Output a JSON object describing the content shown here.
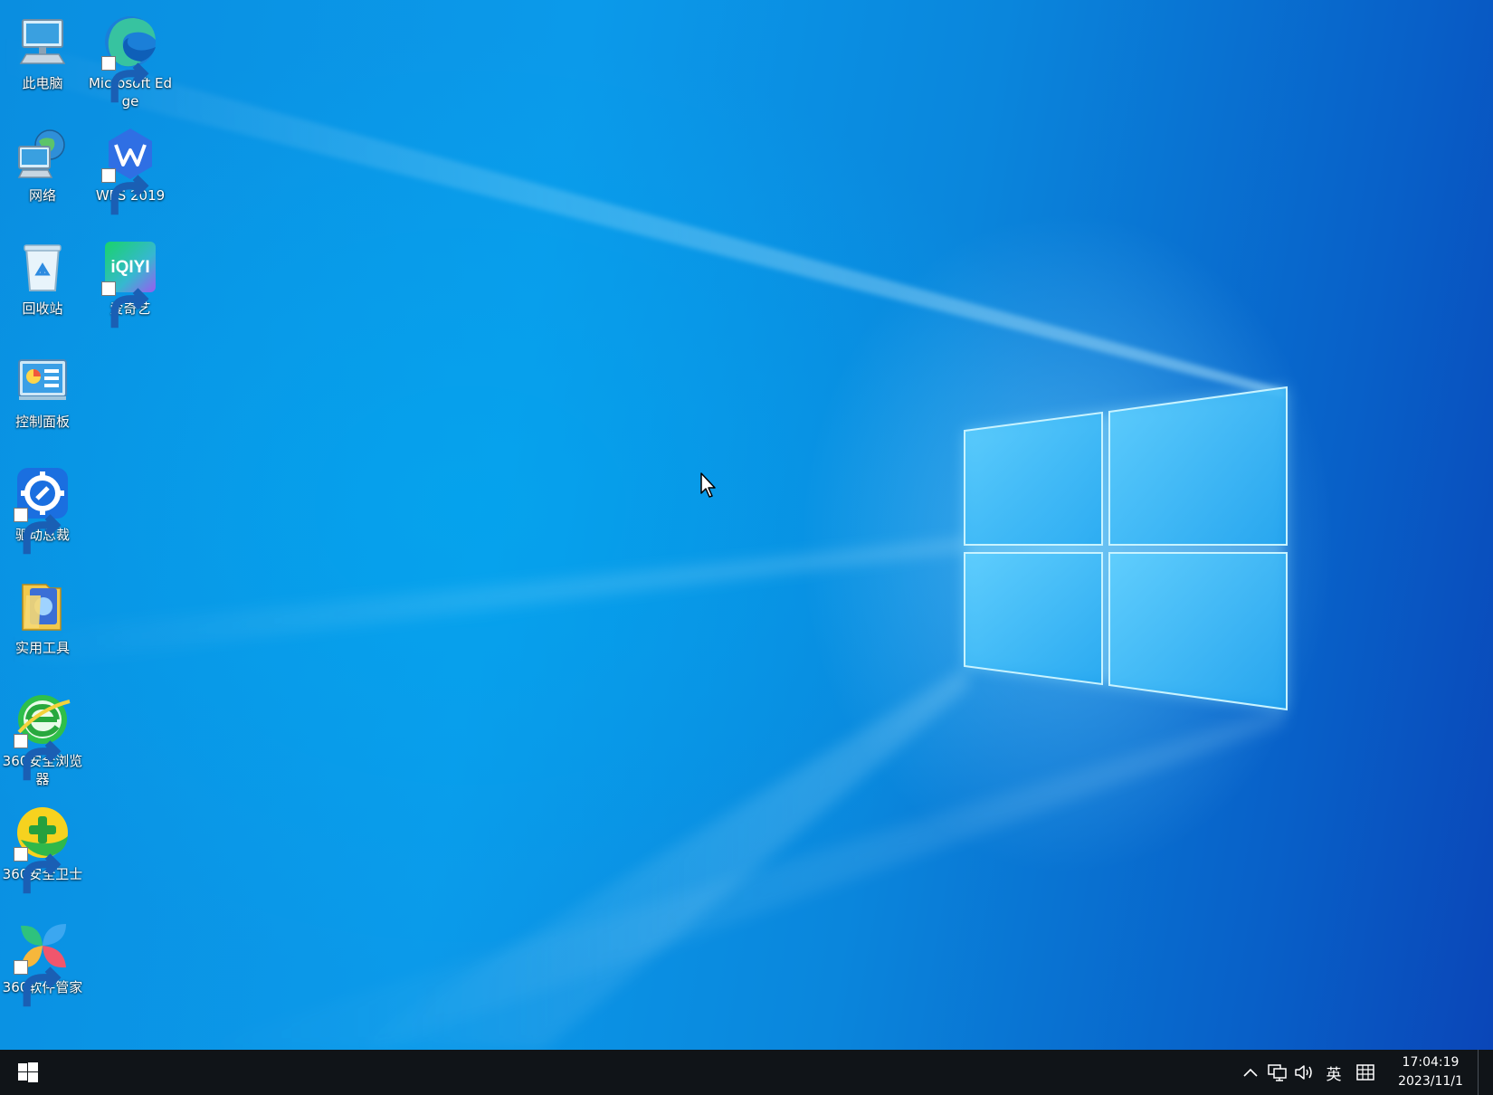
{
  "desktop": {
    "icons": [
      {
        "label": "此电脑"
      },
      {
        "label": "Microsoft Edge"
      },
      {
        "label": "网络"
      },
      {
        "label": "WPS 2019"
      },
      {
        "label": "回收站"
      },
      {
        "label": "爱奇艺"
      },
      {
        "label": "控制面板"
      },
      {
        "label": "驱动总裁"
      },
      {
        "label": "实用工具"
      },
      {
        "label": "360安全浏览器"
      },
      {
        "label": "360安全卫士"
      },
      {
        "label": "360软件管家"
      }
    ],
    "iqiyi_logo_text": "iQIYI",
    "wallpaper_colors": {
      "base": "#0a8ee0",
      "glow": "#7fd6ff",
      "deep": "#0a46b8"
    }
  },
  "taskbar": {
    "tray": {
      "ime_label": "英",
      "time": "17:04:19",
      "date": "2023/11/1"
    },
    "colors": {
      "background": "#101418",
      "text": "#ffffff"
    }
  }
}
